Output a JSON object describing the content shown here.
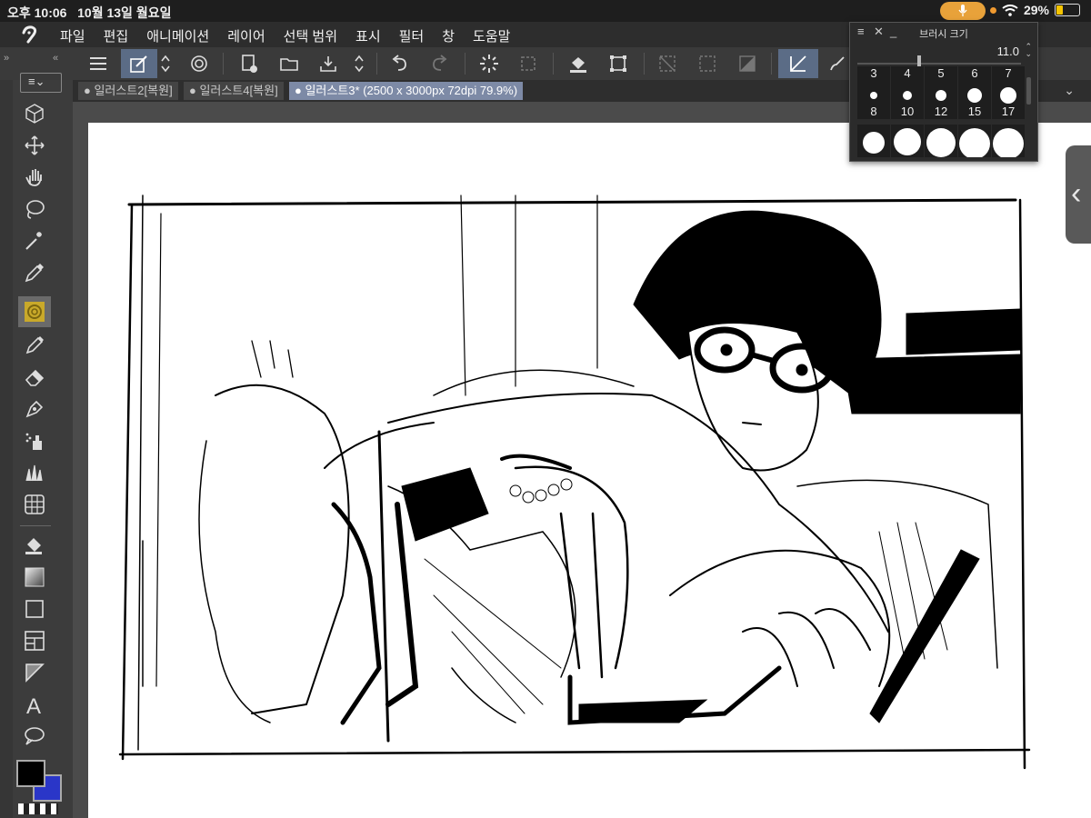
{
  "status": {
    "time": "오후 10:06",
    "date": "10월 13일 월요일",
    "battery": "29%"
  },
  "menu": [
    "파일",
    "편집",
    "애니메이션",
    "레이어",
    "선택 범위",
    "표시",
    "필터",
    "창",
    "도움말"
  ],
  "tabs": [
    {
      "label": "일러스트2[복원]"
    },
    {
      "label": "일러스트4[복원]"
    },
    {
      "label": "일러스트3* (2500 x 3000px 72dpi 79.9%)"
    }
  ],
  "brush_palette": {
    "title": "브러시 크기",
    "value": "11.0",
    "rows": [
      [
        "3",
        "4",
        "5",
        "6",
        "7"
      ],
      [
        "8",
        "10",
        "12",
        "15",
        "17"
      ]
    ]
  },
  "colors": {
    "accent": "#5b6c86",
    "main_color": "#000000",
    "sub_color": "#2a36c8",
    "battery": "#f5c400",
    "mic": "#e8a23a"
  },
  "icons": {
    "toolbar": [
      "menu-icon",
      "brush-edit-icon",
      "updown-icon",
      "spiral-icon",
      "new-file-icon",
      "open-folder-icon",
      "save-icon",
      "updown-icon",
      "undo-icon",
      "redo-icon",
      "spinner-icon",
      "deselect-icon",
      "fill-icon",
      "transform-icon",
      "clear-icon",
      "select-icon",
      "border-icon",
      "snap-ruler-icon",
      "brush-icon"
    ],
    "tools": [
      "3d-cube-icon",
      "move-icon",
      "hand-icon",
      "lasso-icon",
      "magic-wand-icon",
      "eyedropper-icon",
      "decoration-icon",
      "pen-icon",
      "eraser-icon",
      "pen-nib-icon",
      "airbrush-icon",
      "grass-icon",
      "mesh-icon",
      "fill-bucket-icon",
      "gradient-icon",
      "rectangle-icon",
      "frame-icon",
      "ruler-icon",
      "text-icon",
      "balloon-icon"
    ]
  }
}
